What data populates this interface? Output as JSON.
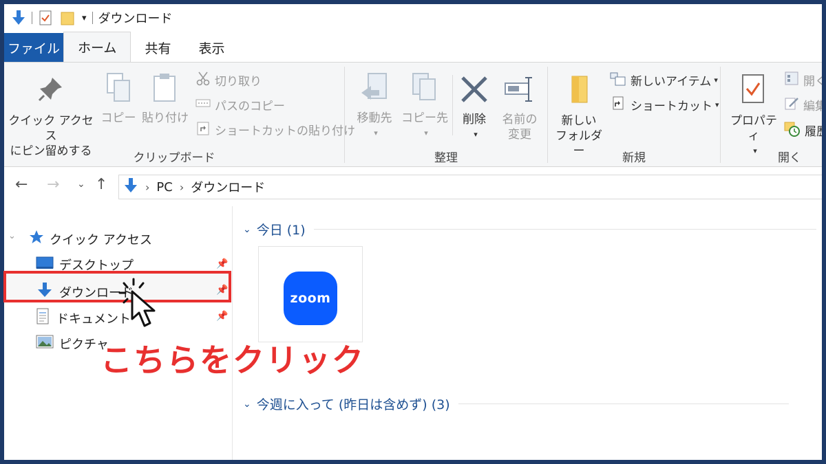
{
  "window": {
    "title": "ダウンロード"
  },
  "ribbon_tabs": [
    "ファイル",
    "ホーム",
    "共有",
    "表示"
  ],
  "ribbon": {
    "clipboard": {
      "label": "クリップボード",
      "pin_quick_access": [
        "クイック アクセス",
        "にピン留めする"
      ],
      "copy": "コピー",
      "paste": "貼り付け",
      "cut": "切り取り",
      "copy_path": "パスのコピー",
      "paste_shortcut": "ショートカットの貼り付け"
    },
    "organize": {
      "label": "整理",
      "move_to": "移動先",
      "copy_to": "コピー先",
      "delete": "削除",
      "rename": [
        "名前の",
        "変更"
      ]
    },
    "new": {
      "label": "新規",
      "new_folder": [
        "新しい",
        "フォルダー"
      ],
      "new_item": "新しいアイテム",
      "shortcut": "ショートカット"
    },
    "open": {
      "label": "開く",
      "properties": "プロパティ",
      "open": "開く",
      "edit": "編集",
      "history": "履歴"
    }
  },
  "address_bar": {
    "crumbs": [
      "PC",
      "ダウンロード"
    ]
  },
  "nav_pane": {
    "quick_access": "クイック アクセス",
    "items": [
      "デスクトップ",
      "ダウンロード",
      "ドキュメント",
      "ピクチャ"
    ]
  },
  "content": {
    "groups": [
      {
        "header": "今日 (1)"
      },
      {
        "header": "今週に入って (昨日は含めず) (3)"
      }
    ],
    "file_icon_text": "zoom"
  },
  "annotation": {
    "callout": "こちらをクリック"
  },
  "colors": {
    "file_tab": "#1a5bab",
    "accent_red": "#e8302f",
    "zoom_blue": "#0b5cff",
    "download_arrow": "#2f7bd6"
  }
}
